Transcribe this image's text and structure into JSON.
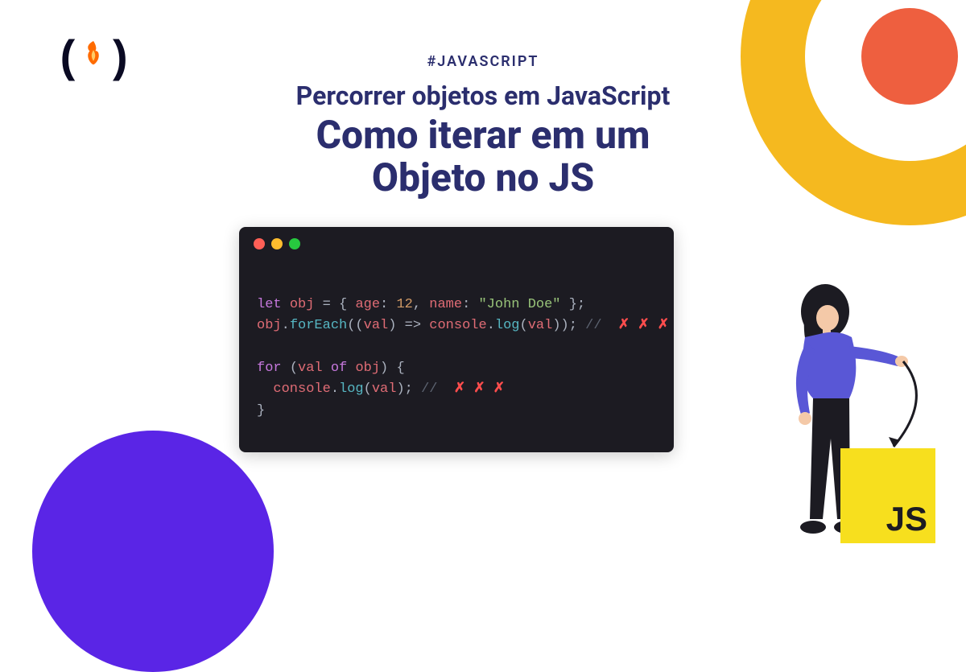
{
  "logo": {
    "open": "(",
    "flame_icon": "flame-icon",
    "close": ")"
  },
  "header": {
    "hashtag": "#JAVASCRIPT",
    "subtitle": "Percorrer objetos em JavaScript",
    "title_line1": "Como iterar em um",
    "title_line2": "Objeto no JS"
  },
  "editor": {
    "code_tokens": [
      [
        {
          "t": "let ",
          "c": "kw"
        },
        {
          "t": "obj",
          "c": "vr"
        },
        {
          "t": " = { ",
          "c": "pr"
        },
        {
          "t": "age",
          "c": "vr"
        },
        {
          "t": ": ",
          "c": "pr"
        },
        {
          "t": "12",
          "c": "nm"
        },
        {
          "t": ", ",
          "c": "pr"
        },
        {
          "t": "name",
          "c": "vr"
        },
        {
          "t": ": ",
          "c": "pr"
        },
        {
          "t": "\"John Doe\"",
          "c": "st"
        },
        {
          "t": " };",
          "c": "pr"
        }
      ],
      [
        {
          "t": "obj",
          "c": "vr"
        },
        {
          "t": ".",
          "c": "pr"
        },
        {
          "t": "forEach",
          "c": "fn"
        },
        {
          "t": "((",
          "c": "pr"
        },
        {
          "t": "val",
          "c": "vr"
        },
        {
          "t": ") => ",
          "c": "pr"
        },
        {
          "t": "console",
          "c": "vr"
        },
        {
          "t": ".",
          "c": "pr"
        },
        {
          "t": "log",
          "c": "fn"
        },
        {
          "t": "(",
          "c": "pr"
        },
        {
          "t": "val",
          "c": "vr"
        },
        {
          "t": ")); ",
          "c": "pr"
        },
        {
          "t": "// ",
          "c": "cm"
        },
        {
          "t": " ✗ ✗ ✗",
          "c": "cross"
        }
      ],
      [],
      [
        {
          "t": "for ",
          "c": "kw"
        },
        {
          "t": "(",
          "c": "pr"
        },
        {
          "t": "val",
          "c": "vr"
        },
        {
          "t": " of ",
          "c": "kw"
        },
        {
          "t": "obj",
          "c": "vr"
        },
        {
          "t": ") {",
          "c": "pr"
        }
      ],
      [
        {
          "t": "  console",
          "c": "vr"
        },
        {
          "t": ".",
          "c": "pr"
        },
        {
          "t": "log",
          "c": "fn"
        },
        {
          "t": "(",
          "c": "pr"
        },
        {
          "t": "val",
          "c": "vr"
        },
        {
          "t": "); ",
          "c": "pr"
        },
        {
          "t": "// ",
          "c": "cm"
        },
        {
          "t": " ✗ ✗ ✗",
          "c": "cross"
        }
      ],
      [
        {
          "t": "}",
          "c": "pr"
        }
      ]
    ]
  },
  "jsbox": {
    "label": "JS"
  },
  "colors": {
    "navy": "#2b2e6e",
    "purple": "#5a25e6",
    "yellow": "#f5b91f",
    "orange": "#ee5f3f",
    "jsYellow": "#f7df1e",
    "editorBg": "#1c1b22"
  }
}
